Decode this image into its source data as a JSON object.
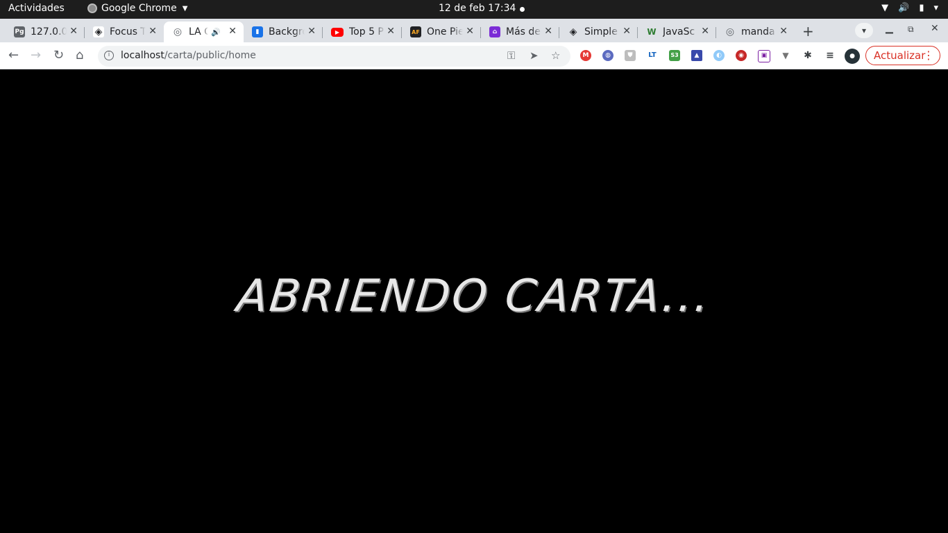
{
  "os_bar": {
    "activities": "Actividades",
    "app_name": "Google Chrome",
    "clock": "12 de feb  17:34"
  },
  "tabs": [
    {
      "title": "127.0.0",
      "favicon": "pg-icon",
      "fav_color": "#5f6368",
      "fav_text": "Pg"
    },
    {
      "title": "Focus T",
      "favicon": "codepen-icon",
      "fav_color": "#202124",
      "fav_text": "◈"
    },
    {
      "title": "LA C",
      "favicon": "globe-icon",
      "fav_color": "#5f6368",
      "fav_text": "◎",
      "active": true,
      "audio": "🔊"
    },
    {
      "title": "Backgro",
      "favicon": "bg-icon",
      "fav_color": "#1a73e8",
      "fav_text": "▮"
    },
    {
      "title": "Top 5 P",
      "favicon": "youtube-icon",
      "fav_color": "#ff0000",
      "fav_text": "▶"
    },
    {
      "title": "One Pie",
      "favicon": "af-icon",
      "fav_color": "#202124",
      "fav_text": "AF"
    },
    {
      "title": "Más de",
      "favicon": "twitch-icon",
      "fav_color": "#7b2cd6",
      "fav_text": "⌂"
    },
    {
      "title": "Simple",
      "favicon": "codepen-icon",
      "fav_color": "#202124",
      "fav_text": "◈"
    },
    {
      "title": "JavaSc",
      "favicon": "w-icon",
      "fav_color": "#2e7d32",
      "fav_text": "W"
    },
    {
      "title": "manda",
      "favicon": "globe-icon",
      "fav_color": "#5f6368",
      "fav_text": "◎"
    }
  ],
  "omnibox": {
    "host": "localhost",
    "path": "/carta/public/home"
  },
  "update_button": "Actualizar",
  "page": {
    "loading_text": "ABRIENDO CARTA..."
  }
}
